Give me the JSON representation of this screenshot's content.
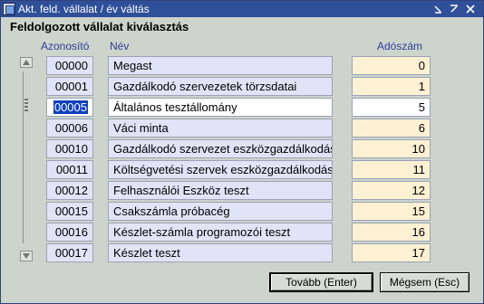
{
  "window": {
    "title": "Akt. feld. vállalat / év váltás",
    "controls": [
      "minimize-icon",
      "restore-icon",
      "close-icon"
    ]
  },
  "section_title": "Feldolgozott vállalat kiválasztás",
  "columns": {
    "id": "Azonosító",
    "name": "Név",
    "tax": "Adószám"
  },
  "rows": [
    {
      "id": "00000",
      "name": "Megast",
      "tax": "0"
    },
    {
      "id": "00001",
      "name": "Gazdálkodó szervezetek törzsdatai",
      "tax": "1"
    },
    {
      "id": "00005",
      "name": "Általános tesztállomány",
      "tax": "5",
      "selected": true
    },
    {
      "id": "00006",
      "name": "Váci minta",
      "tax": "6"
    },
    {
      "id": "00010",
      "name": "Gazdálkodó szervezet eszközgazdálkodás",
      "tax": "10"
    },
    {
      "id": "00011",
      "name": "Költségvetési szervek eszközgazdálkodás",
      "tax": "11"
    },
    {
      "id": "00012",
      "name": "Felhasználói Eszköz teszt",
      "tax": "12"
    },
    {
      "id": "00015",
      "name": "Csakszámla próbacég",
      "tax": "15"
    },
    {
      "id": "00016",
      "name": "Készlet-számla programozói teszt",
      "tax": "16"
    },
    {
      "id": "00017",
      "name": "Készlet teszt",
      "tax": "17"
    }
  ],
  "buttons": {
    "next": "Tovább (Enter)",
    "cancel": "Mégsem (Esc)"
  },
  "colors": {
    "titlebar": "#2f4f99",
    "window_bg": "#ccd4cc",
    "field_bg": "#dfe5f7",
    "tax_bg": "#fdf0d3",
    "selection": "#1040c0",
    "header_text": "#2f3f99"
  }
}
